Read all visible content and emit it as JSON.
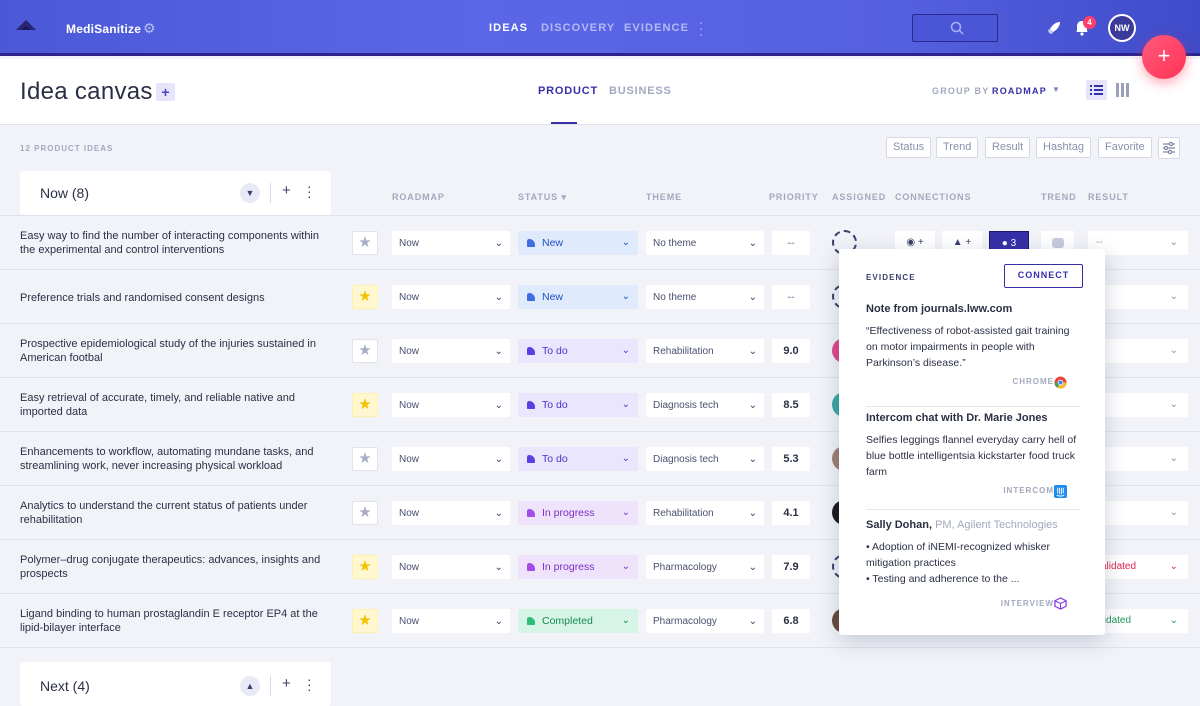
{
  "app": {
    "brand": "MediSanitize",
    "nav": [
      "IDEAS",
      "DISCOVERY",
      "EVIDENCE"
    ],
    "notification_count": "4",
    "user_initials": "NW",
    "fab_label": "+"
  },
  "page": {
    "title": "Idea canvas",
    "title_plus": "+",
    "tabs": [
      "PRODUCT",
      "BUSINESS"
    ],
    "group_by_label": "GROUP BY",
    "group_by_value": "ROADMAP",
    "ideas_count": "12 PRODUCT IDEAS",
    "filters": [
      "Status",
      "Trend",
      "Result",
      "Hashtag",
      "Favorite"
    ]
  },
  "columns": {
    "roadmap": "ROADMAP",
    "status": "STATUS ▾",
    "theme": "THEME",
    "priority": "PRIORITY",
    "assigned": "ASSIGNED",
    "connections": "CONNECTIONS",
    "trend": "TREND",
    "result": "RESULT"
  },
  "groups": [
    {
      "name": "Now (8)"
    },
    {
      "name": "Next (4)"
    }
  ],
  "rows": [
    {
      "name": "Easy way to find the number of interacting components within the experimental and control interventions",
      "fav": false,
      "roadmap": "Now",
      "status": "New",
      "theme": "No theme",
      "priority": "--",
      "result": "--"
    },
    {
      "name": "Preference trials and randomised consent designs",
      "fav": true,
      "roadmap": "Now",
      "status": "New",
      "theme": "No theme",
      "priority": "--",
      "result": ""
    },
    {
      "name": "Prospective epidemiological study of the injuries sustained in American footbal",
      "fav": false,
      "roadmap": "Now",
      "status": "To do",
      "theme": "Rehabilitation",
      "priority": "9.0",
      "result": ""
    },
    {
      "name": "Easy retrieval of accurate, timely, and reliable native and imported data",
      "fav": true,
      "roadmap": "Now",
      "status": "To do",
      "theme": "Diagnosis tech",
      "priority": "8.5",
      "result": ""
    },
    {
      "name": "Enhancements to workflow, automating mundane tasks, and streamlining work, never increasing physical workload",
      "fav": false,
      "roadmap": "Now",
      "status": "To do",
      "theme": "Diagnosis tech",
      "priority": "5.3",
      "result": ""
    },
    {
      "name": "Analytics to understand the current status of patients under rehabilitation",
      "fav": false,
      "roadmap": "Now",
      "status": "In progress",
      "theme": "Rehabilitation",
      "priority": "4.1",
      "result": ""
    },
    {
      "name": "Polymer–drug conjugate therapeutics: advances, insights and prospects",
      "fav": true,
      "roadmap": "Now",
      "status": "In progress",
      "theme": "Pharmacology",
      "priority": "7.9",
      "result": "validated"
    },
    {
      "name": "Ligand binding to human prostaglandin E receptor EP4 at the lipid-bilayer interface",
      "fav": true,
      "roadmap": "Now",
      "status": "Completed",
      "theme": "Pharmacology",
      "priority": "6.8",
      "result": "alidated"
    }
  ],
  "connections_row1": {
    "a": "+",
    "b": "+",
    "evidence": "3"
  },
  "evidence_popover": {
    "title": "EVIDENCE",
    "connect": "CONNECT",
    "items": [
      {
        "head": "Note from journals.lww.com",
        "role": "",
        "body": "“Effectiveness of robot-assisted gait training on motor impairments in people with Parkinson’s disease.”",
        "source": "CHROME"
      },
      {
        "head": "Intercom chat with Dr. Marie Jones",
        "role": "",
        "body": "Selfies leggings flannel everyday carry hell of blue bottle intelligentsia kickstarter food truck farm",
        "source": "INTERCOM"
      },
      {
        "head": "Sally Dohan,",
        "role": "PM, Agilent Technologies",
        "body1": "• Adoption of iNEMI-recognized whisker mitigation practices",
        "body2": "• Testing and adherence to the ...",
        "source": "INTERVIEW"
      }
    ]
  },
  "colors": {
    "accent": "#3630a8",
    "topbar": "#5560e0",
    "fab": "#ff3d6a",
    "validated_red": "#e0284f",
    "validated_green": "#1f9a5a"
  }
}
